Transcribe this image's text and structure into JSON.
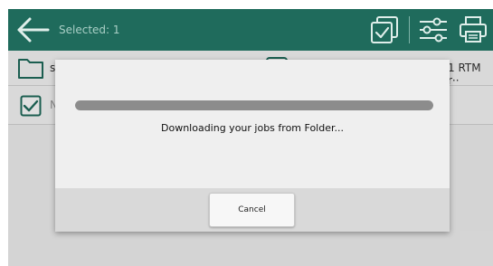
{
  "header": {
    "selected_label": "Selected: 1",
    "back_icon": "back-arrow-icon",
    "select_all_icon": "select-all-icon",
    "filter_icon": "sliders-filter-icon",
    "print_icon": "printer-icon"
  },
  "list": {
    "row1_left_text": "s",
    "row1_right_text": "1 RTM r··",
    "row2_left_text": "N"
  },
  "dialog": {
    "message": "Downloading your jobs from Folder...",
    "progress_fraction": 1.0,
    "cancel_label": "Cancel"
  },
  "colors": {
    "header_bg": "#1f6b5c",
    "icon_color": "#dfeeea",
    "folder_border": "#1f6b5c"
  }
}
